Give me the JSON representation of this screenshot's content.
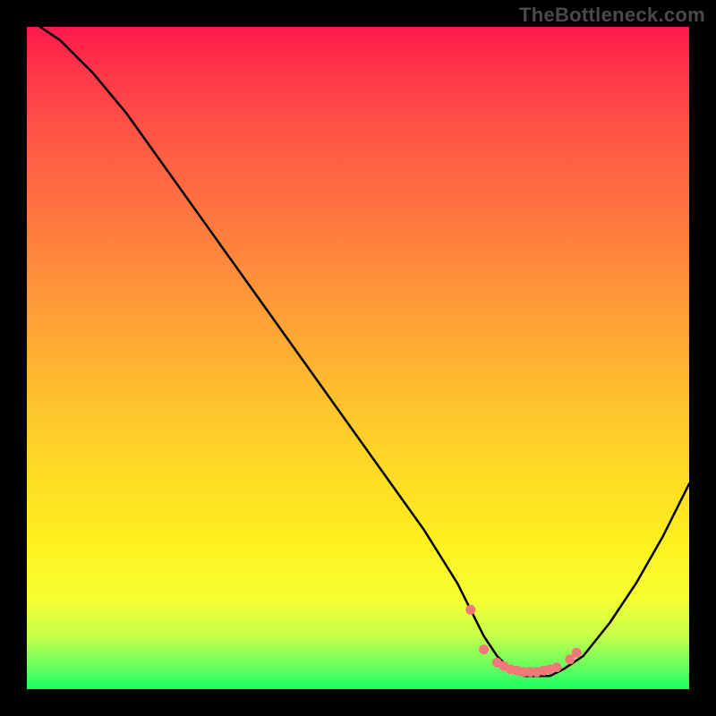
{
  "watermark": "TheBottleneck.com",
  "chart_data": {
    "type": "line",
    "title": "",
    "xlabel": "",
    "ylabel": "",
    "xlim": [
      0,
      100
    ],
    "ylim": [
      0,
      100
    ],
    "series": [
      {
        "name": "bottleneck-curve",
        "x": [
          2,
          5,
          10,
          15,
          20,
          25,
          30,
          35,
          40,
          45,
          50,
          55,
          60,
          65,
          67,
          69,
          71,
          73,
          75,
          77,
          79,
          81,
          84,
          88,
          92,
          96,
          100
        ],
        "y": [
          100,
          98,
          93,
          87,
          80,
          73,
          66,
          59,
          52,
          45,
          38,
          31,
          24,
          16,
          12,
          8,
          5,
          3,
          2,
          2,
          2,
          3,
          5,
          10,
          16,
          23,
          31
        ]
      }
    ],
    "markers": {
      "name": "optimal-range",
      "x": [
        67,
        69,
        71,
        72,
        73,
        74,
        75,
        76,
        77,
        78,
        79,
        80,
        82,
        83
      ],
      "y": [
        12,
        6,
        4,
        3.5,
        3,
        2.8,
        2.6,
        2.6,
        2.6,
        2.8,
        3,
        3.3,
        4.5,
        5.5
      ]
    },
    "gradient_stops": [
      {
        "pos": 0,
        "color": "#ff1a4b"
      },
      {
        "pos": 8,
        "color": "#ff3b49"
      },
      {
        "pos": 18,
        "color": "#ff5a45"
      },
      {
        "pos": 30,
        "color": "#ff7a3f"
      },
      {
        "pos": 42,
        "color": "#ff9b38"
      },
      {
        "pos": 55,
        "color": "#ffbd2f"
      },
      {
        "pos": 66,
        "color": "#ffd826"
      },
      {
        "pos": 78,
        "color": "#fff01f"
      },
      {
        "pos": 86,
        "color": "#f6ff30"
      },
      {
        "pos": 92,
        "color": "#c6ff4a"
      },
      {
        "pos": 97,
        "color": "#5fff5f"
      },
      {
        "pos": 100,
        "color": "#19ff62"
      }
    ],
    "colors": {
      "curve": "#000000",
      "markers": "#f07878",
      "background_frame": "#000000"
    }
  }
}
